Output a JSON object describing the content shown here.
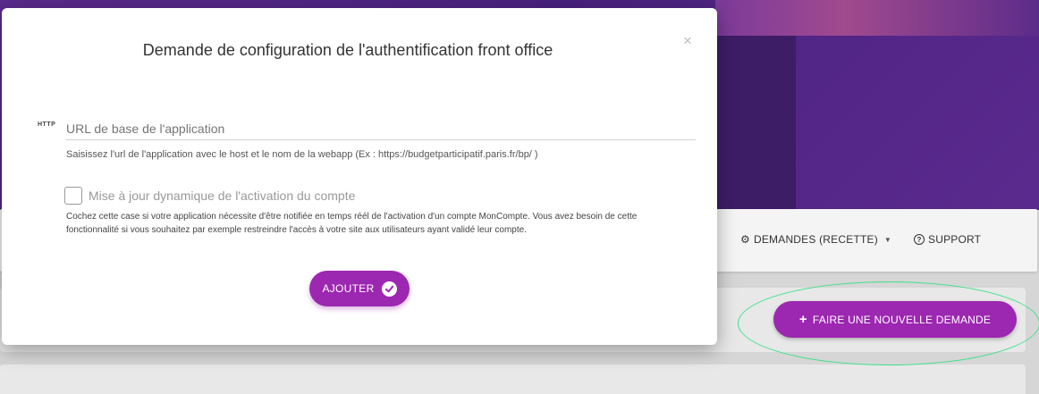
{
  "modal": {
    "title": "Demande de configuration de l'authentification front office",
    "close_label": "×",
    "url_field": {
      "icon_label": "HTTP",
      "placeholder": "URL de base de l'application",
      "value": "",
      "help": "Saisissez l'url de l'application avec le host et le nom de la webapp (Ex : https://budgetparticipatif.paris.fr/bp/ )"
    },
    "dynamic_update": {
      "label": "Mise à jour dynamique de l'activation du compte",
      "checked": false,
      "help": "Cochez cette case si votre application nécessite d'être notifiée en temps réél de l'activation d'un compte MonCompte. Vous avez besoin de cette fonctionnalité si vous souhaitez par exemple restreindre l'accès à votre site aux utilisateurs ayant validé leur compte."
    },
    "add_button_label": "AJOUTER"
  },
  "background": {
    "nav": {
      "separator": ":",
      "demandes_label": "DEMANDES (RECETTE)",
      "support_label": "SUPPORT"
    },
    "new_request_button_label": "FAIRE UNE NOUVELLE DEMANDE"
  },
  "colors": {
    "accent": "#9c27b0",
    "hero": "#4a2280",
    "highlight": "#3ee08a"
  },
  "icons": {
    "close": "close-icon",
    "http": "http-icon",
    "check": "check-circle-icon",
    "gear": "gear-icon",
    "caret": "caret-down-icon",
    "help": "question-circle-icon",
    "plus": "plus-icon"
  }
}
